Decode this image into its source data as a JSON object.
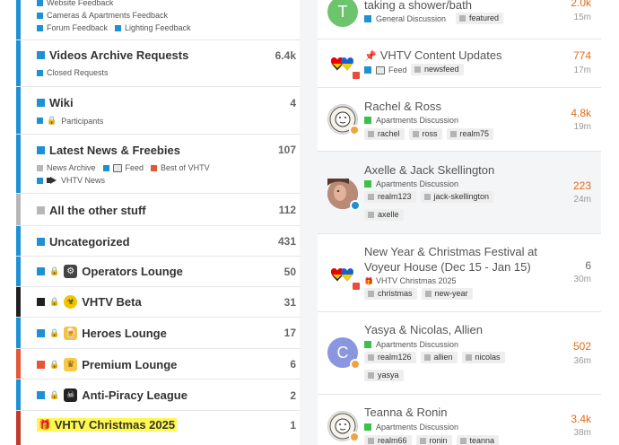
{
  "colors": {
    "blue": "#1e90d4",
    "green": "#3bc14a",
    "gray": "#b7b7b7",
    "black": "#231f20",
    "red": "#c0392b",
    "orange": "#e45735",
    "highlight": "#fff84f",
    "reply_orange": "#e06c1b",
    "reply_gray": "#666666"
  },
  "categories": {
    "top_subcats": {
      "line1": "Website Feedback",
      "line2a": "Cameras & Apartments Feedback",
      "line3a": "Forum Feedback",
      "line3b": "Lighting Feedback"
    },
    "videos": {
      "title": "Videos Archive Requests",
      "count": "6.4k",
      "sub1": "Closed Requests"
    },
    "wiki": {
      "title": "Wiki",
      "count": "4",
      "sub1": "Participants"
    },
    "news": {
      "title": "Latest News & Freebies",
      "count": "107",
      "sub1": "News Archive",
      "sub2": "Feed",
      "sub3": "Best of VHTV",
      "sub4": "VHTV News"
    },
    "other": {
      "title": "All the other stuff",
      "count": "112"
    },
    "uncat": {
      "title": "Uncategorized",
      "count": "431"
    },
    "operators": {
      "title": "Operators Lounge",
      "count": "50"
    },
    "beta": {
      "title": "VHTV Beta",
      "count": "31"
    },
    "heroes": {
      "title": "Heroes Lounge",
      "count": "17"
    },
    "premium": {
      "title": "Premium Lounge",
      "count": "6"
    },
    "antipiracy": {
      "title": "Anti-Piracy League",
      "count": "2"
    },
    "christmas": {
      "title": "VHTV Christmas 2025",
      "count": "1"
    }
  },
  "topics": {
    "t0": {
      "title": "taking a shower/bath",
      "category": "General Discussion",
      "tags": [
        "featured"
      ],
      "replies": "2.0k",
      "ago": "15m",
      "avatar_letter": "T"
    },
    "t1": {
      "title": "VHTV Content Updates",
      "category": "Feed",
      "tags": [
        "newsfeed"
      ],
      "replies": "774",
      "ago": "17m"
    },
    "t2": {
      "title": "Rachel & Ross",
      "category": "Apartments Discussion",
      "tags": [
        "rachel",
        "ross",
        "realm75"
      ],
      "replies": "4.8k",
      "ago": "19m"
    },
    "t3": {
      "title": "Axelle & Jack Skellington",
      "category": "Apartments Discussion",
      "tags": [
        "realm123",
        "jack-skellington",
        "axelle"
      ],
      "replies": "223",
      "ago": "24m"
    },
    "t4": {
      "title_line1": "New Year & Christmas Festival at",
      "title_line2": "Voyeur House (Dec 15 - Jan 15)",
      "category": "VHTV Christmas 2025",
      "tags": [
        "christmas",
        "new-year"
      ],
      "replies": "6",
      "ago": "30m"
    },
    "t5": {
      "title": "Yasya & Nicolas, Allien",
      "category": "Apartments Discussion",
      "tags": [
        "realm126",
        "allien",
        "nicolas",
        "yasya"
      ],
      "replies": "502",
      "ago": "36m",
      "avatar_letter": "C"
    },
    "t6": {
      "title": "Teanna & Ronin",
      "category": "Apartments Discussion",
      "tags": [
        "realm66",
        "ronin",
        "teanna"
      ],
      "replies": "3.4k",
      "ago": "38m"
    }
  }
}
